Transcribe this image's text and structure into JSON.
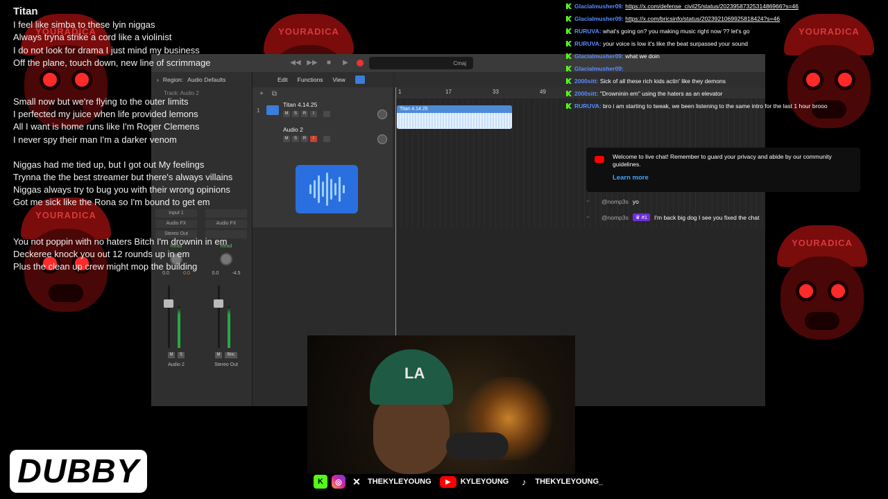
{
  "background": {
    "mascot_caption": "YOURADICA",
    "accent_color": "#b30f0f"
  },
  "lyrics": {
    "title": "Titan",
    "stanzas": [
      [
        "I feel like simba to these lyin niggas",
        "Always tryna strike a cord like a violinist",
        "I do not look for drama I just mind my business",
        "Off the plane, touch down, new line of scrimmage"
      ],
      [
        "Small now but we're flying to the outer limits",
        "I perfected my juice when life provided lemons",
        "All I want is home runs like I'm Roger Clemens",
        "I never spy  their man I'm a darker venom"
      ],
      [
        "Niggas had me tied up, but I got out My feelings",
        "Trynna the the best streamer  but there's always villains",
        "Niggas always try to bug you with their wrong opinions",
        "Got me sick like the Rona so I'm bound to get em"
      ],
      [
        "You not poppin with no haters Bitch I'm drownin in em",
        "Deckeree knock you out 12 rounds up in em",
        "Plus the clean up crew might mop the building"
      ]
    ]
  },
  "daw": {
    "key": "Cmaj",
    "region_label": "Region:",
    "region_name": "Audio Defaults",
    "track_header_label": "Track: Audio 2",
    "toolbar": {
      "edit": "Edit",
      "functions": "Functions",
      "view": "View"
    },
    "ruler": [
      "1",
      "17",
      "33",
      "49"
    ],
    "tracks": [
      {
        "number": "1",
        "name": "Titan 4.14.25"
      },
      {
        "number": "",
        "name": "Audio 2"
      }
    ],
    "region_title": "Titan 4.14.25",
    "strips": [
      {
        "input": "Input 1",
        "fx": "Audio FX",
        "out": "Stereo Out",
        "read": "Read",
        "val1": "0.0",
        "val2": "0.0",
        "name": "Audio 2"
      },
      {
        "input": "",
        "fx": "Audio FX",
        "out": "",
        "read": "Read",
        "val1": "0.0",
        "val2": "-4.5",
        "name": "Stereo Out",
        "bounce": "Bnc"
      }
    ]
  },
  "chat": {
    "messages": [
      {
        "user": "Glacialmusher09:",
        "text": "https://x.com/defense_civil25/status/2023958732531486966?s=46",
        "link": true
      },
      {
        "user": "Glacialmusher09:",
        "text": "https://x.com/bricsinfo/status/2023921069925818424?s=46",
        "link": true
      },
      {
        "user": "RURUVA:",
        "text": "what's going on? you making music right now ?? let's go"
      },
      {
        "user": "RURUVA:",
        "text": "your voice is low it's like the beat surpassed your sound"
      },
      {
        "user": "Glacialmusher09:",
        "text": "what we doin"
      },
      {
        "user": "Glacialmusher09:",
        "text": ""
      },
      {
        "user": "2000sitt:",
        "text": "Sick of all these rich kids actin' like they demons"
      },
      {
        "user": "2000sitt:",
        "text": "\"Drowninin em\" using the haters as an elevator"
      },
      {
        "user": "RURUVA:",
        "text": "bro i am starting to tweak, we been listening to the same intro for the last 1 hour brooo"
      }
    ],
    "notice": {
      "text": "Welcome to live chat! Remember to guard your privacy and abide by our community guidelines.",
      "link": "Learn more"
    },
    "yt_messages": [
      {
        "author": "@nomp3s",
        "text": "yo",
        "badge": ""
      },
      {
        "author": "@nomp3s",
        "text": "I'm back big dog I see you fixed the chat",
        "badge": "#1"
      }
    ]
  },
  "socials": {
    "x": "THEKYLEYOUNG",
    "youtube": "KYLEYOUNG",
    "tiktok": "THEKYLEYOUNG_"
  },
  "webcam": {
    "hat_text": "LA"
  },
  "logo": {
    "text": "DUBBY"
  }
}
